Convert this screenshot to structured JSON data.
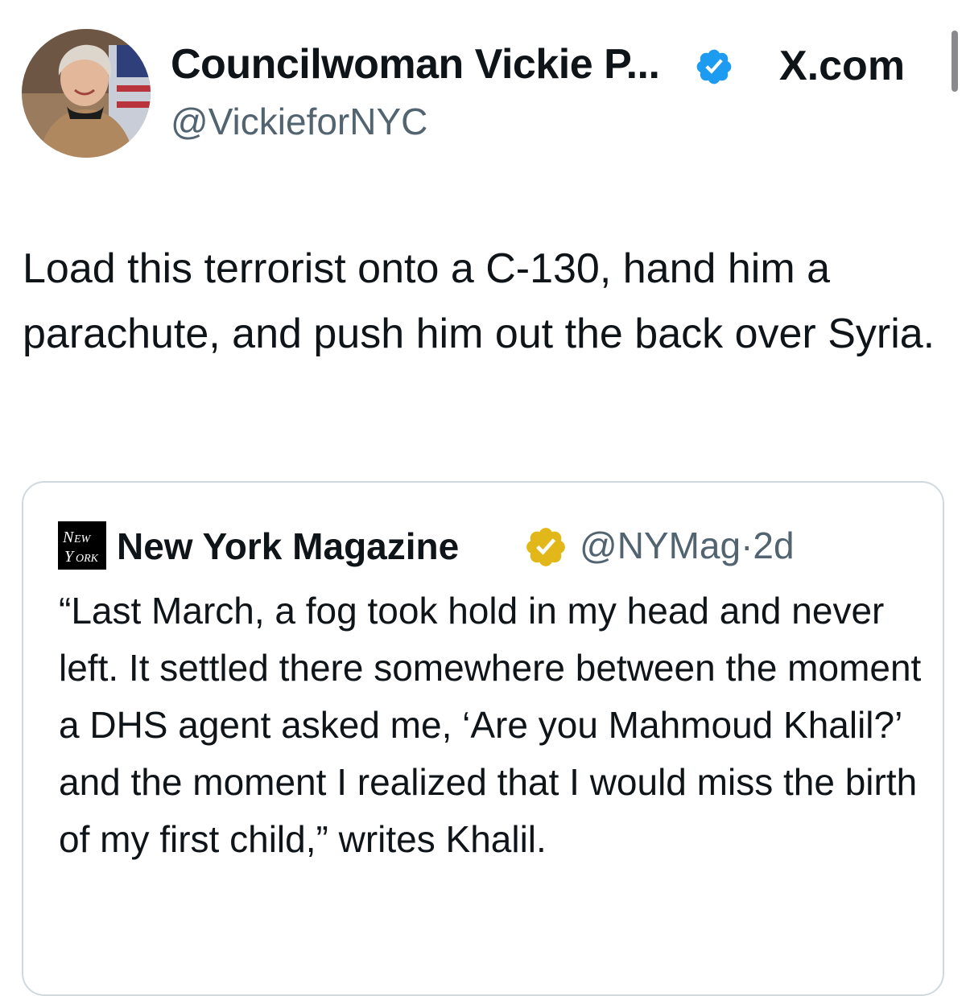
{
  "tweet": {
    "author": {
      "name": "Councilwoman Vickie P...",
      "handle": "@VickieforNYC",
      "verified_icon": "verified-badge-blue",
      "avatar_icon": "profile-photo"
    },
    "source_label": "X.com",
    "text": "Load this terrorist onto a C-130, hand him a parachute, and push him out the back over Syria."
  },
  "quoted_tweet": {
    "logo_text": "New York",
    "author_name": "New York Magazine",
    "verified_icon": "verified-badge-gold",
    "handle": "@NYMag",
    "separator": "·",
    "age": "2d",
    "text": "“Last March, a fog took hold in my head and never left. It settled there somewhere between the moment a DHS agent asked me, ‘Are you Mahmoud Khalil?’ and the moment I realized that I would miss the birth of my first child,” writes Khalil."
  },
  "colors": {
    "text_primary": "#0f1419",
    "text_secondary": "#536471",
    "verified_blue": "#1d9bf0",
    "verified_gold": "#e2b719",
    "card_border": "#cfd9de"
  }
}
